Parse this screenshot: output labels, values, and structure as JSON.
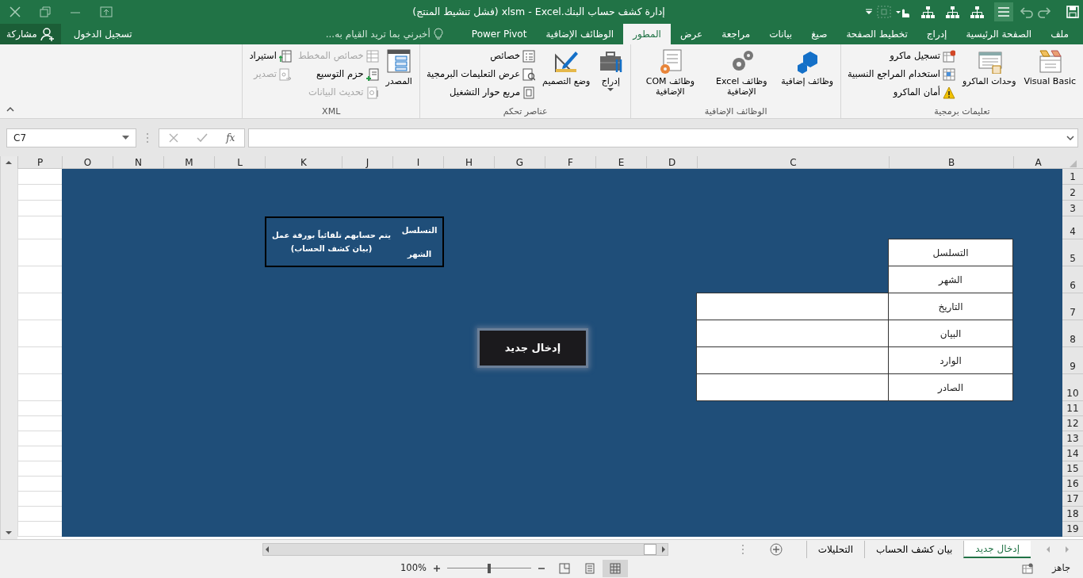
{
  "title_bar": {
    "title": "إدارة كشف حساب البنك.xlsm - Excel (فشل تنشيط المنتج)"
  },
  "ribbon_tabs": [
    {
      "label": "ملف",
      "selected": false
    },
    {
      "label": "الصفحة الرئيسية",
      "selected": false
    },
    {
      "label": "إدراج",
      "selected": false
    },
    {
      "label": "تخطيط الصفحة",
      "selected": false
    },
    {
      "label": "صيغ",
      "selected": false
    },
    {
      "label": "بيانات",
      "selected": false
    },
    {
      "label": "مراجعة",
      "selected": false
    },
    {
      "label": "عرض",
      "selected": false
    },
    {
      "label": "المطور",
      "selected": true
    },
    {
      "label": "الوظائف الإضافية",
      "selected": false
    },
    {
      "label": "Power Pivot",
      "selected": false
    }
  ],
  "tell_me": {
    "placeholder": "أخبرني بما تريد القيام به..."
  },
  "account": {
    "sign_in": "تسجيل الدخول",
    "share": "مشاركة"
  },
  "ribbon_groups": [
    {
      "label": "تعليمات برمجية",
      "items": [
        {
          "kind": "large",
          "label": "Visual Basic",
          "disabled": false,
          "dropdown": false
        },
        {
          "kind": "large",
          "label": "وحدات الماكرو",
          "disabled": false,
          "dropdown": false
        },
        {
          "kind": "small",
          "label": "تسجيل ماكرو",
          "disabled": false
        },
        {
          "kind": "small",
          "label": "استخدام المراجع النسبية",
          "disabled": false
        },
        {
          "kind": "small",
          "label": "أمان الماكرو",
          "disabled": false
        }
      ]
    },
    {
      "label": "الوظائف الإضافية",
      "items": [
        {
          "kind": "large",
          "label": "وظائف إضافية",
          "disabled": false,
          "dropdown": false
        },
        {
          "kind": "large",
          "label": "وظائف Excel الإضافية",
          "disabled": false,
          "dropdown": false
        },
        {
          "kind": "large",
          "label": "وظائف COM الإضافية",
          "disabled": false,
          "dropdown": false
        }
      ]
    },
    {
      "label": "عناصر تحكم",
      "items": [
        {
          "kind": "large",
          "label": "إدراج",
          "disabled": false,
          "dropdown": true
        },
        {
          "kind": "large",
          "label": "وضع التصميم",
          "disabled": false,
          "dropdown": false
        },
        {
          "kind": "small",
          "label": "خصائص",
          "disabled": false
        },
        {
          "kind": "small",
          "label": "عرض التعليمات البرمجية",
          "disabled": false
        },
        {
          "kind": "small",
          "label": "مربع حوار التشغيل",
          "disabled": false
        }
      ]
    },
    {
      "label": "XML",
      "items": [
        {
          "kind": "large",
          "label": "المصدر",
          "disabled": false,
          "dropdown": false
        },
        {
          "kind": "small",
          "label": "خصائص المخطط",
          "disabled": true
        },
        {
          "kind": "small",
          "label": "حزم التوسيع",
          "disabled": false
        },
        {
          "kind": "small",
          "label": "تحديث البيانات",
          "disabled": true
        },
        {
          "kind": "small",
          "label": "استيراد",
          "disabled": false
        },
        {
          "kind": "small",
          "label": "تصدير",
          "disabled": true
        }
      ]
    }
  ],
  "formula_bar": {
    "name_box": "C7",
    "function_label": "fx"
  },
  "sheet": {
    "columns": [
      "A",
      "B",
      "C",
      "D",
      "E",
      "F",
      "G",
      "H",
      "I",
      "J",
      "K",
      "L",
      "M",
      "N",
      "O",
      "P"
    ],
    "rows": [
      "1",
      "2",
      "3",
      "4",
      "5",
      "6",
      "7",
      "8",
      "9",
      "10",
      "11",
      "12",
      "13",
      "14",
      "15",
      "16",
      "17",
      "18",
      "19"
    ],
    "form_rows": [
      {
        "label": "التسلسل",
        "input": false
      },
      {
        "label": "الشهر",
        "input": false
      },
      {
        "label": "التاريخ",
        "input": true
      },
      {
        "label": "البيان",
        "input": true
      },
      {
        "label": "الوارد",
        "input": true
      },
      {
        "label": "الصادر",
        "input": true
      }
    ],
    "note_box": {
      "fields": [
        "التسلسل",
        "الشهر"
      ],
      "lines": [
        "يتم حسابهم تلقائياً بورقة عمل",
        "(بيان كشف الحساب)"
      ]
    },
    "action_button": {
      "label": "إدخال جديد"
    }
  },
  "sheet_tabs": [
    {
      "label": "إدخال جديد",
      "selected": true
    },
    {
      "label": "بيان كشف الحساب",
      "selected": false
    },
    {
      "label": "التحليلات",
      "selected": false
    }
  ],
  "status_bar": {
    "status": "جاهز",
    "zoom": "100%",
    "zoom_slider": {
      "level": 0.5
    },
    "views": [
      {
        "selected": true
      },
      {
        "selected": false
      },
      {
        "selected": false
      }
    ]
  }
}
